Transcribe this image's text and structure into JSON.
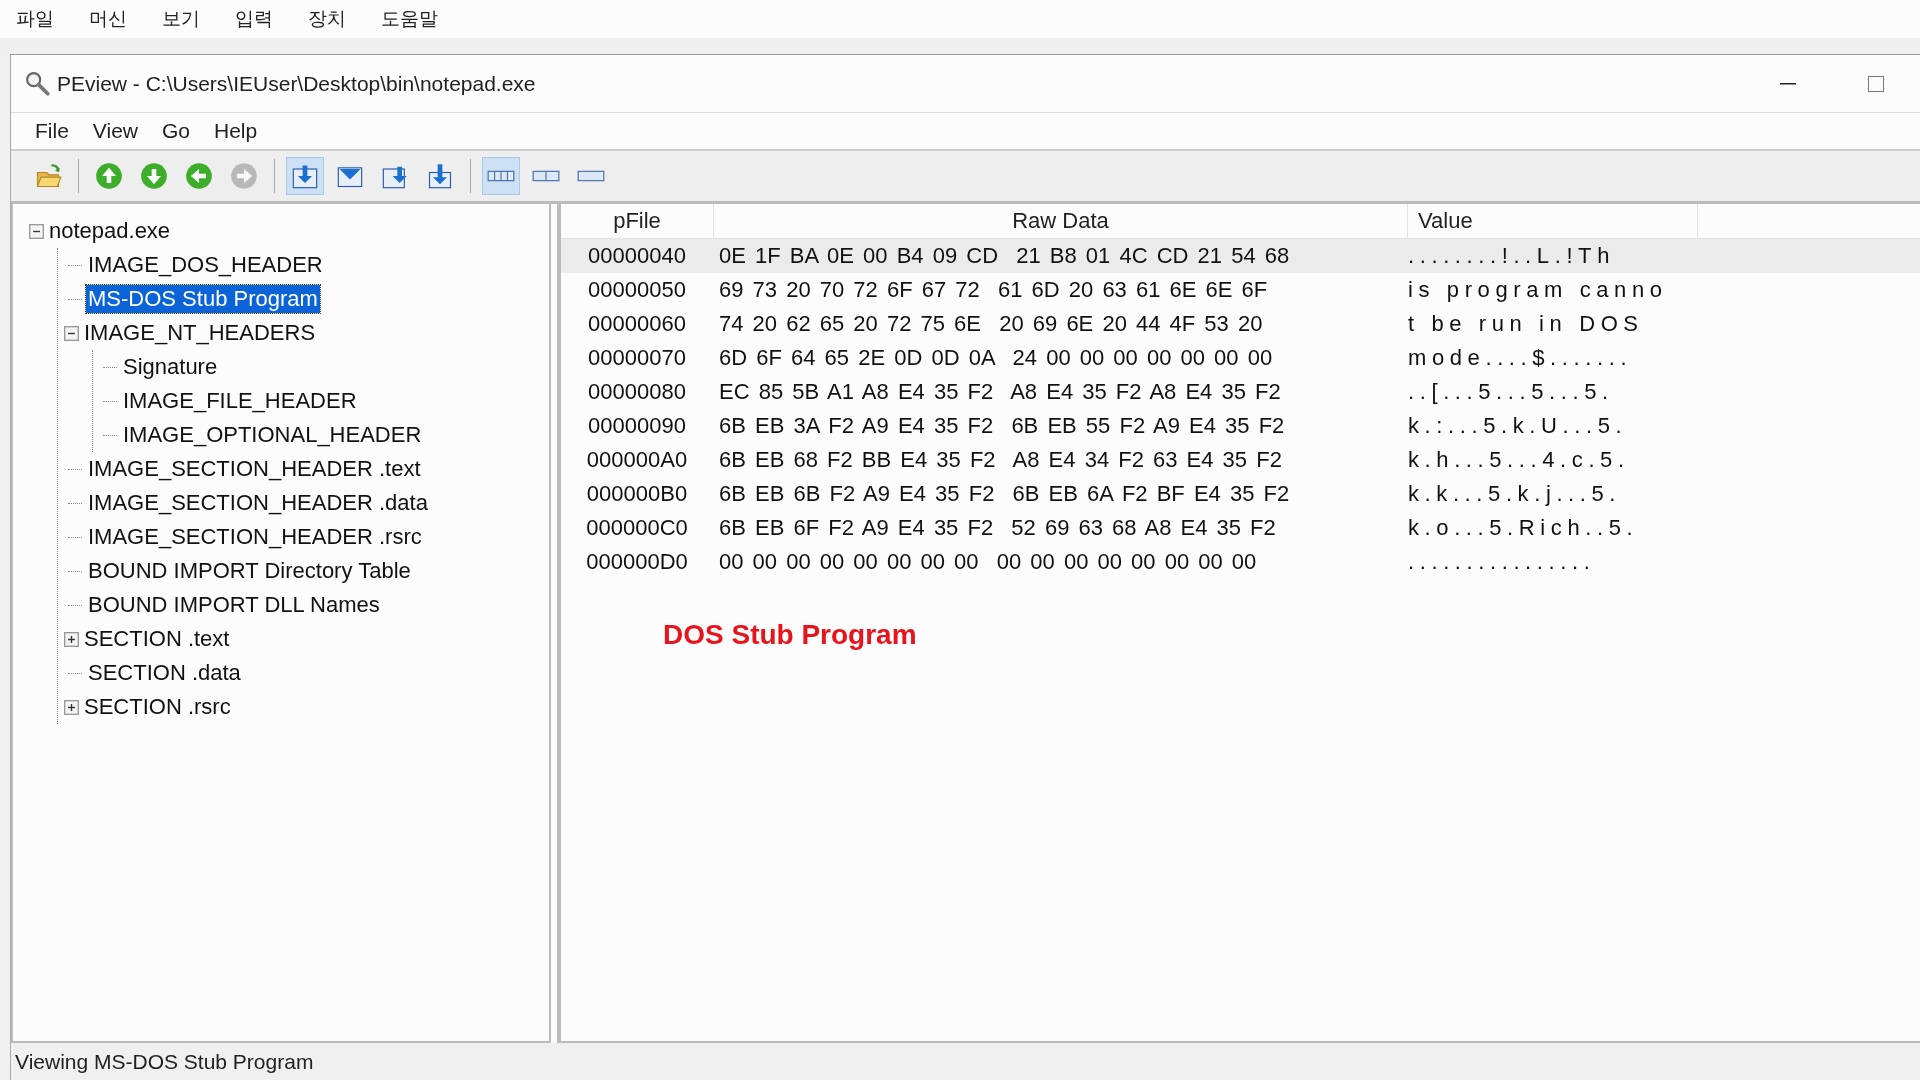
{
  "host_menu": [
    "파일",
    "머신",
    "보기",
    "입력",
    "장치",
    "도움말"
  ],
  "window": {
    "title": "PEview - C:\\Users\\IEUser\\Desktop\\bin\\notepad.exe"
  },
  "menu": [
    "File",
    "View",
    "Go",
    "Help"
  ],
  "toolbar": [
    {
      "kind": "open",
      "pressed": false,
      "disabled": false
    },
    {
      "kind": "sep"
    },
    {
      "kind": "up",
      "pressed": false,
      "disabled": false
    },
    {
      "kind": "down",
      "pressed": false,
      "disabled": false
    },
    {
      "kind": "back",
      "pressed": false,
      "disabled": false
    },
    {
      "kind": "forward",
      "pressed": false,
      "disabled": true
    },
    {
      "kind": "sep"
    },
    {
      "kind": "view1",
      "pressed": true,
      "disabled": false
    },
    {
      "kind": "view2",
      "pressed": false,
      "disabled": false
    },
    {
      "kind": "view3",
      "pressed": false,
      "disabled": false
    },
    {
      "kind": "view4",
      "pressed": false,
      "disabled": false
    },
    {
      "kind": "sep"
    },
    {
      "kind": "cols4",
      "pressed": true,
      "disabled": false
    },
    {
      "kind": "cols2",
      "pressed": false,
      "disabled": false
    },
    {
      "kind": "cols1",
      "pressed": false,
      "disabled": false
    }
  ],
  "tree": [
    {
      "label": "notepad.exe",
      "selected": false,
      "expanded": true,
      "children": [
        {
          "label": "IMAGE_DOS_HEADER",
          "selected": false
        },
        {
          "label": "MS-DOS Stub Program",
          "selected": true
        },
        {
          "label": "IMAGE_NT_HEADERS",
          "selected": false,
          "expanded": true,
          "children": [
            {
              "label": "Signature",
              "selected": false
            },
            {
              "label": "IMAGE_FILE_HEADER",
              "selected": false
            },
            {
              "label": "IMAGE_OPTIONAL_HEADER",
              "selected": false
            }
          ]
        },
        {
          "label": "IMAGE_SECTION_HEADER .text",
          "selected": false
        },
        {
          "label": "IMAGE_SECTION_HEADER .data",
          "selected": false
        },
        {
          "label": "IMAGE_SECTION_HEADER .rsrc",
          "selected": false
        },
        {
          "label": "BOUND IMPORT Directory Table",
          "selected": false
        },
        {
          "label": "BOUND IMPORT DLL Names",
          "selected": false
        },
        {
          "label": "SECTION .text",
          "selected": false,
          "expanded": false
        },
        {
          "label": "SECTION .data",
          "selected": false
        },
        {
          "label": "SECTION .rsrc",
          "selected": false,
          "expanded": false
        }
      ]
    }
  ],
  "table": {
    "columns": [
      "pFile",
      "Raw Data",
      "Value"
    ],
    "rows": [
      {
        "pfile": "00000040",
        "raw": "0E 1F BA 0E 00 B4 09 CD  21 B8 01 4C CD 21 54 68",
        "value": "........!..L.!Th",
        "selected": true
      },
      {
        "pfile": "00000050",
        "raw": "69 73 20 70 72 6F 67 72  61 6D 20 63 61 6E 6E 6F",
        "value": "is program canno",
        "selected": false
      },
      {
        "pfile": "00000060",
        "raw": "74 20 62 65 20 72 75 6E  20 69 6E 20 44 4F 53 20",
        "value": "t be run in DOS",
        "selected": false
      },
      {
        "pfile": "00000070",
        "raw": "6D 6F 64 65 2E 0D 0D 0A  24 00 00 00 00 00 00 00",
        "value": "mode....$.......",
        "selected": false
      },
      {
        "pfile": "00000080",
        "raw": "EC 85 5B A1 A8 E4 35 F2  A8 E4 35 F2 A8 E4 35 F2",
        "value": "..[...5...5...5.",
        "selected": false
      },
      {
        "pfile": "00000090",
        "raw": "6B EB 3A F2 A9 E4 35 F2  6B EB 55 F2 A9 E4 35 F2",
        "value": "k.:...5.k.U...5.",
        "selected": false
      },
      {
        "pfile": "000000A0",
        "raw": "6B EB 68 F2 BB E4 35 F2  A8 E4 34 F2 63 E4 35 F2",
        "value": "k.h...5...4.c.5.",
        "selected": false
      },
      {
        "pfile": "000000B0",
        "raw": "6B EB 6B F2 A9 E4 35 F2  6B EB 6A F2 BF E4 35 F2",
        "value": "k.k...5.k.j...5.",
        "selected": false
      },
      {
        "pfile": "000000C0",
        "raw": "6B EB 6F F2 A9 E4 35 F2  52 69 63 68 A8 E4 35 F2",
        "value": "k.o...5.Rich..5.",
        "selected": false
      },
      {
        "pfile": "000000D0",
        "raw": "00 00 00 00 00 00 00 00  00 00 00 00 00 00 00 00",
        "value": "................",
        "selected": false
      }
    ]
  },
  "annotation": "DOS Stub Program",
  "status_bar": "Viewing MS-DOS Stub Program"
}
